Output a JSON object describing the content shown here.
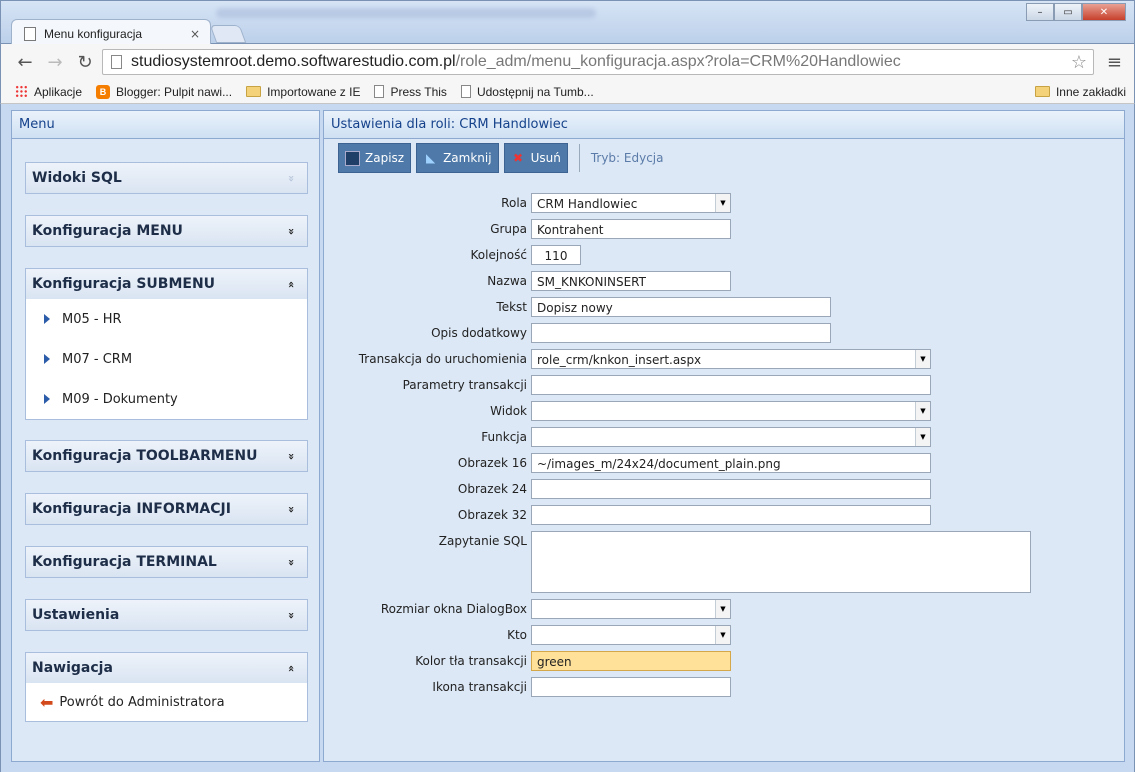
{
  "browser": {
    "tab_title": "Menu konfiguracja",
    "tab_close": "×",
    "url_host": "studiosystemroot.demo.softwarestudio.com.pl",
    "url_path": "/role_adm/menu_konfiguracja.aspx?rola=CRM%20Handlowiec",
    "window_buttons": {
      "minimize": "–",
      "maximize": "▭",
      "close": "✕"
    },
    "nav": {
      "back": "←",
      "forward": "→",
      "reload": "↻",
      "star": "☆",
      "menu": "≡"
    },
    "bookmarks": [
      {
        "label": "Aplikacje",
        "icon": "apps-icon"
      },
      {
        "label": "Blogger: Pulpit nawi...",
        "icon": "blogger-icon"
      },
      {
        "label": "Importowane z IE",
        "icon": "folder-icon"
      },
      {
        "label": "Press This",
        "icon": "page-icon"
      },
      {
        "label": "Udostępnij na Tumb...",
        "icon": "page-icon"
      }
    ],
    "other_bookmarks": "Inne zakładki"
  },
  "left": {
    "title": "Menu",
    "sections": [
      {
        "label": "Widoki SQL",
        "chevron": "»"
      },
      {
        "label": "Konfiguracja MENU",
        "chevron": "»"
      },
      {
        "label": "Konfiguracja SUBMENU",
        "chevron": "«",
        "items": [
          "M05 - HR",
          "M07 - CRM",
          "M09 - Dokumenty"
        ]
      },
      {
        "label": "Konfiguracja TOOLBARMENU",
        "chevron": "»"
      },
      {
        "label": "Konfiguracja INFORMACJI",
        "chevron": "»"
      },
      {
        "label": "Konfiguracja TERMINAL",
        "chevron": "»"
      },
      {
        "label": "Ustawienia",
        "chevron": "»"
      },
      {
        "label": "Nawigacja",
        "chevron": "«",
        "items": [
          "Powrót do Administratora"
        ]
      }
    ]
  },
  "right": {
    "title": "Ustawienia dla roli: CRM Handlowiec",
    "toolbar": {
      "save": "Zapisz",
      "close": "Zamknij",
      "delete": "Usuń",
      "mode": "Tryb: Edycja"
    },
    "form": {
      "rola": {
        "label": "Rola",
        "value": "CRM Handlowiec"
      },
      "grupa": {
        "label": "Grupa",
        "value": "Kontrahent"
      },
      "kolejnosc": {
        "label": "Kolejność",
        "value": "110"
      },
      "nazwa": {
        "label": "Nazwa",
        "value": "SM_KNKONINSERT"
      },
      "tekst": {
        "label": "Tekst",
        "value": "Dopisz nowy"
      },
      "opis": {
        "label": "Opis dodatkowy",
        "value": ""
      },
      "transakcja": {
        "label": "Transakcja do uruchomienia",
        "value": "role_crm/knkon_insert.aspx"
      },
      "parametry": {
        "label": "Parametry transakcji",
        "value": ""
      },
      "widok": {
        "label": "Widok",
        "value": ""
      },
      "funkcja": {
        "label": "Funkcja",
        "value": ""
      },
      "obrazek16": {
        "label": "Obrazek 16",
        "value": "~/images_m/24x24/document_plain.png"
      },
      "obrazek24": {
        "label": "Obrazek 24",
        "value": ""
      },
      "obrazek32": {
        "label": "Obrazek 32",
        "value": ""
      },
      "zapytanie": {
        "label": "Zapytanie SQL",
        "value": ""
      },
      "rozmiar": {
        "label": "Rozmiar okna DialogBox",
        "value": ""
      },
      "kto": {
        "label": "Kto",
        "value": ""
      },
      "kolor": {
        "label": "Kolor tła transakcji",
        "value": "green"
      },
      "ikona": {
        "label": "Ikona transakcji",
        "value": ""
      }
    }
  },
  "colors": {
    "accent": "#4e79a8",
    "panel_bg": "#dce8f6",
    "header_text": "#15428b",
    "focus_field": "#ffe19a"
  }
}
